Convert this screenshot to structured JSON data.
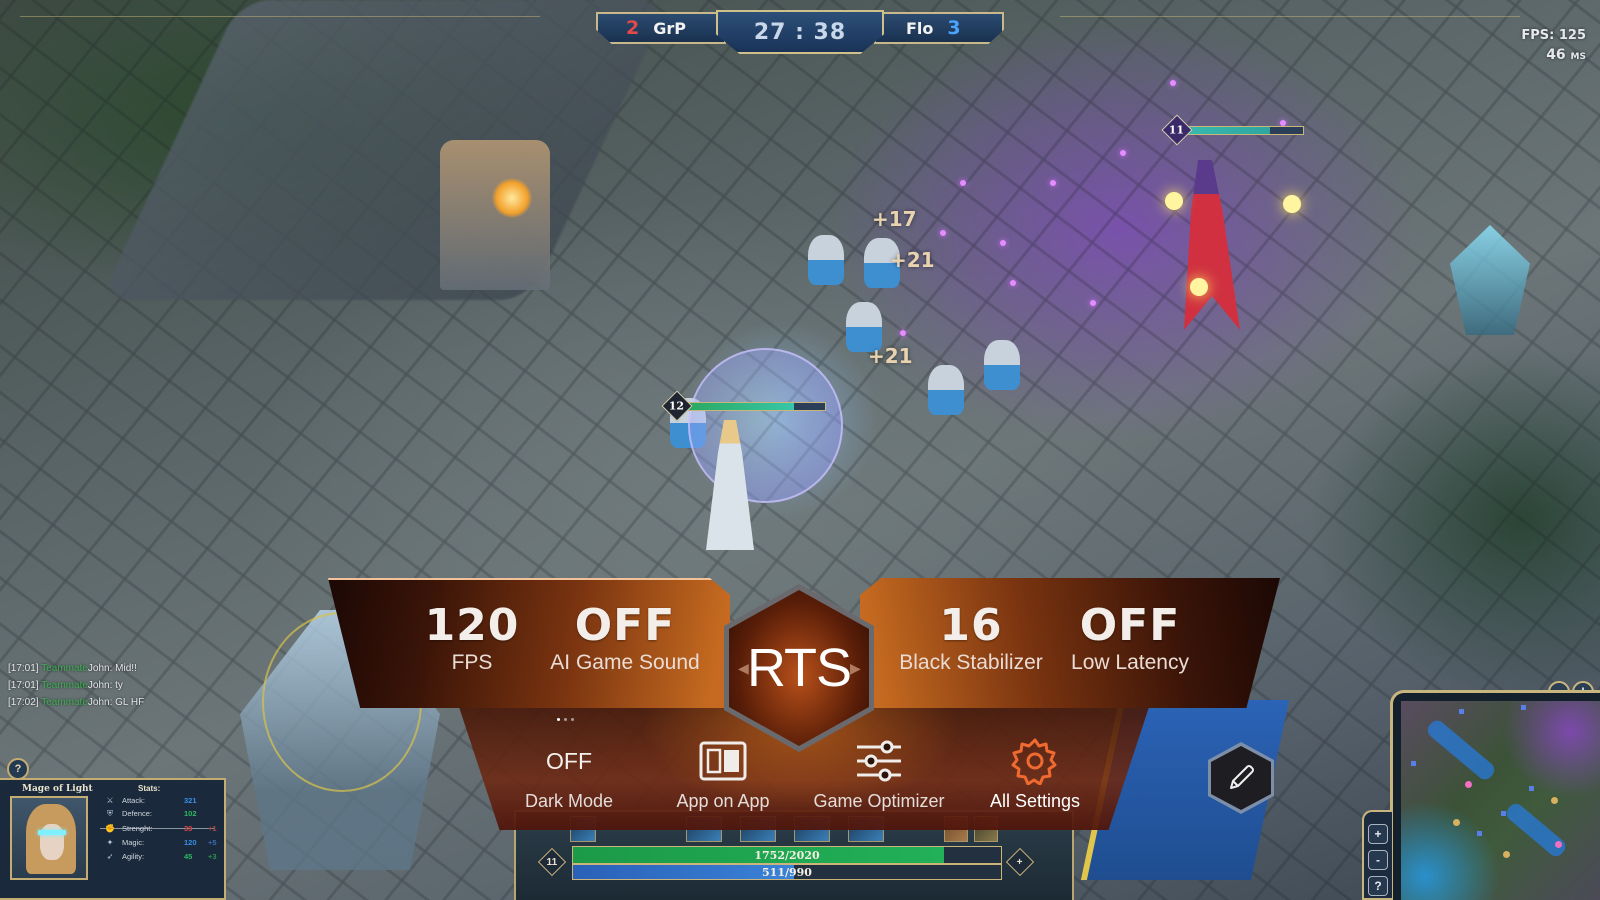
{
  "scoreboard": {
    "left_team": "GrP",
    "left_score": "2",
    "right_team": "Flo",
    "right_score": "3",
    "timer": "27 : 38"
  },
  "performance": {
    "fps": "FPS: 125",
    "latency_value": "46",
    "latency_unit": "MS"
  },
  "damage_numbers": [
    "+17",
    "+21",
    "+21"
  ],
  "units": {
    "player_level": "12",
    "player_health_fraction": 0.78,
    "enemy_level": "11",
    "enemy_health_fraction": 0.72
  },
  "chat": [
    {
      "time": "[17:01]",
      "sender": "Teammate",
      "name": "John:",
      "message": "Mid!!"
    },
    {
      "time": "[17:01]",
      "sender": "Teammate",
      "name": "John:",
      "message": "ty"
    },
    {
      "time": "[17:02]",
      "sender": "Teammate",
      "name": "John:",
      "message": "GL HF"
    }
  ],
  "champion": {
    "help": "?",
    "name": "Mage of Light",
    "stats_title": "Stats:",
    "stats": [
      {
        "icon": "sword-icon",
        "glyph": "⚔",
        "label": "Attack:",
        "value": "321",
        "bonus": "",
        "value_color": "#3a8fe8",
        "bonus_color": ""
      },
      {
        "icon": "shield-icon",
        "glyph": "⛨",
        "label": "Defence:",
        "value": "102",
        "bonus": "",
        "value_color": "#2fb860",
        "bonus_color": ""
      },
      {
        "icon": "strength-icon",
        "glyph": "✊",
        "label": "Strenght:",
        "value": "39",
        "bonus": "+1",
        "value_color": "#d94848",
        "bonus_color": "#b34a4a"
      },
      {
        "icon": "magic-icon",
        "glyph": "✦",
        "label": "Magic:",
        "value": "120",
        "bonus": "+5",
        "value_color": "#3a8fe8",
        "bonus_color": "#3d6cb0"
      },
      {
        "icon": "agility-icon",
        "glyph": "➶",
        "label": "Agility:",
        "value": "45",
        "bonus": "+3",
        "value_color": "#2fb860",
        "bonus_color": "#2f9050"
      }
    ]
  },
  "ability_bar": {
    "level": "11",
    "plus": "+",
    "hp_text": "1752/2020",
    "hp_fraction": 0.867,
    "mp_text": "511/990",
    "mp_fraction": 0.516
  },
  "minimap": {
    "zoom_in": "+",
    "zoom_out": "-",
    "help": "?",
    "alert": "!"
  },
  "game_bar": {
    "mode": "RTS",
    "stats": [
      {
        "value": "120",
        "label": "FPS"
      },
      {
        "value": "OFF",
        "label": "AI Game Sound"
      },
      {
        "value": "16",
        "label": "Black Stabilizer"
      },
      {
        "value": "OFF",
        "label": "Low Latency"
      }
    ],
    "page_indicator": {
      "total": 3,
      "current": 1
    },
    "tools": [
      {
        "label": "Dark Mode",
        "state": "OFF"
      },
      {
        "label": "App on App",
        "icon": "app-on-app-icon"
      },
      {
        "label": "Game Optimizer",
        "icon": "sliders-icon"
      },
      {
        "label": "All Settings",
        "icon": "gear-icon",
        "active": true
      }
    ],
    "accent_color": "#f06a30"
  }
}
